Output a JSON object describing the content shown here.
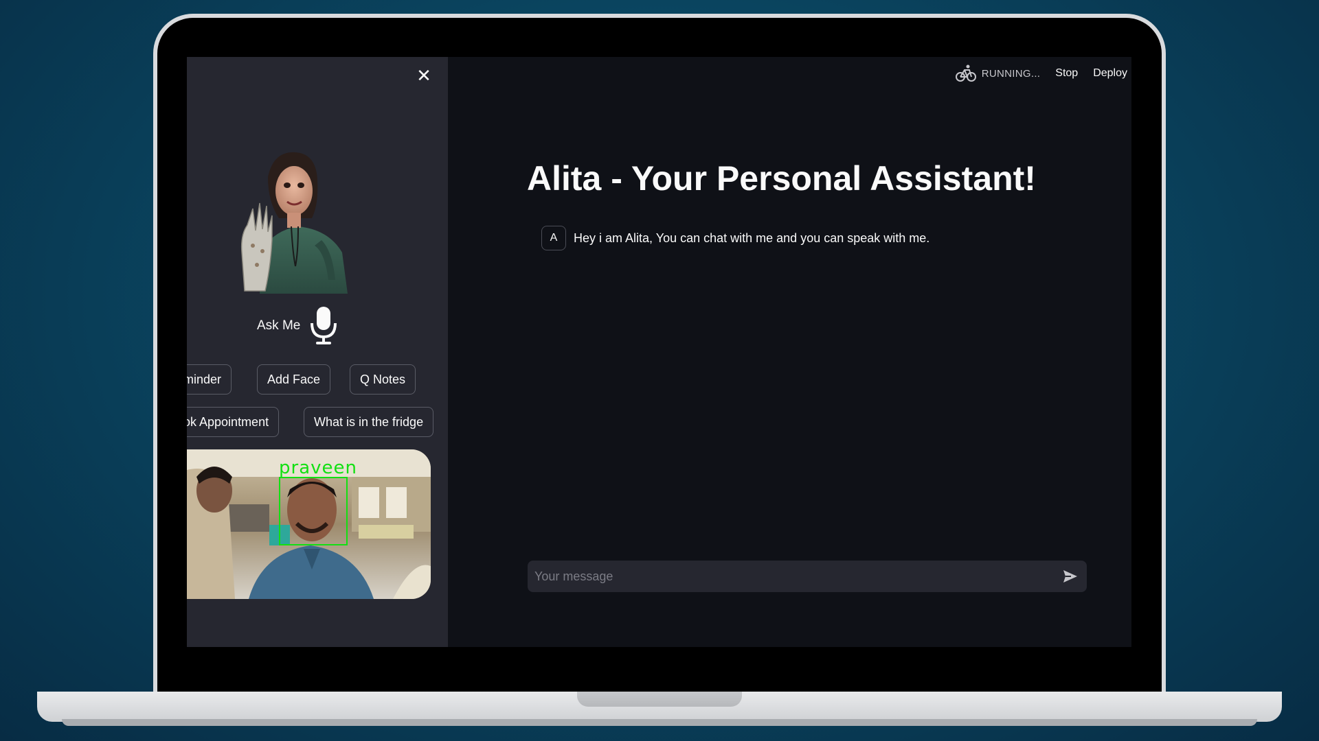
{
  "topbar": {
    "status": "RUNNING...",
    "stop_label": "Stop",
    "deploy_label": "Deploy",
    "status_icon": "bicycle-icon"
  },
  "sidebar": {
    "close_icon": "close-icon",
    "ask_label": "Ask Me",
    "mic_icon": "microphone-icon",
    "chips_row1": [
      "minder",
      "Add Face",
      "Q Notes"
    ],
    "chips_row2": [
      "ok Appointment",
      "What is in the fridge"
    ],
    "camera": {
      "detected_name": "praveen"
    }
  },
  "main": {
    "title": "Alita - Your Personal Assistant!",
    "messages": [
      {
        "avatar": "A",
        "text": "Hey i am Alita, You can chat with me and you can speak with me."
      }
    ],
    "input": {
      "placeholder": "Your message",
      "value": "",
      "send_icon": "send-icon"
    }
  },
  "colors": {
    "app_bg": "#0f1117",
    "sidebar_bg": "#262730",
    "text": "#fafafa",
    "face_box": "#12e012"
  }
}
